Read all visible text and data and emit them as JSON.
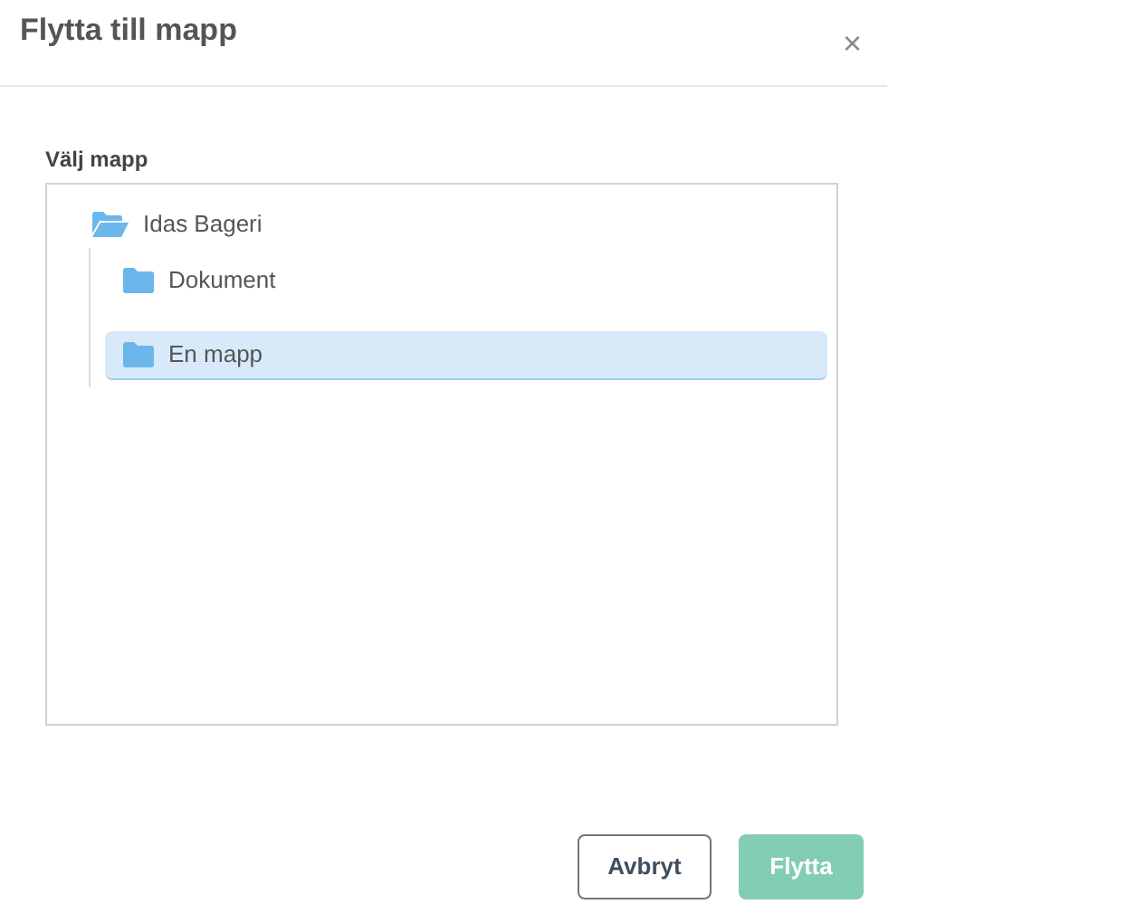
{
  "dialog": {
    "title": "Flytta till mapp",
    "close": "×"
  },
  "folder_picker": {
    "label": "Välj mapp",
    "tree": [
      {
        "label": "Idas Bageri",
        "expanded": true,
        "selected": false,
        "children": [
          {
            "label": "Dokument",
            "expanded": false,
            "selected": false
          },
          {
            "label": "En mapp",
            "expanded": false,
            "selected": true
          }
        ]
      }
    ]
  },
  "buttons": [
    {
      "label": "Avbryt",
      "kind": "secondary",
      "disabled": false
    },
    {
      "label": "Flytta",
      "kind": "primary",
      "disabled": true
    }
  ]
}
